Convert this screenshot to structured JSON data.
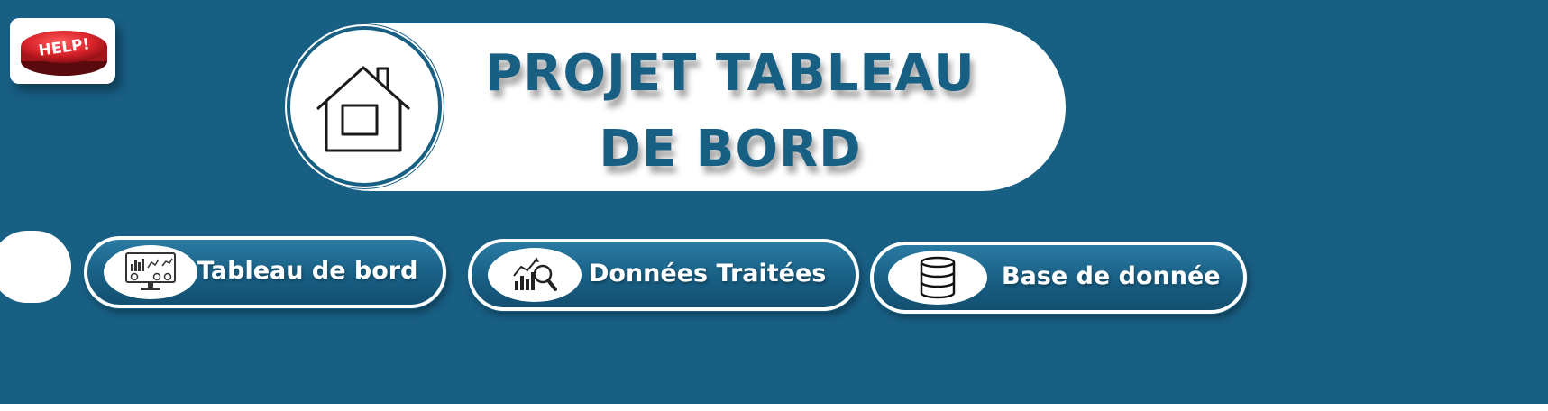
{
  "help_button": {
    "label": "HELP!",
    "icon": "help-button-icon"
  },
  "header": {
    "home_icon": "home-icon",
    "title_line1": "PROJET TABLEAU",
    "title_line2": "DE BORD"
  },
  "nav": {
    "items": [
      {
        "label": "Tableau de bord",
        "icon": "dashboard-monitor-icon"
      },
      {
        "label": "Données Traitées",
        "icon": "chart-magnifier-icon"
      },
      {
        "label": "Base de donnée",
        "icon": "database-icon"
      }
    ]
  },
  "colors": {
    "background": "#185f84",
    "accent": "#185f84",
    "surface": "#ffffff",
    "help_red": "#d8232a"
  }
}
